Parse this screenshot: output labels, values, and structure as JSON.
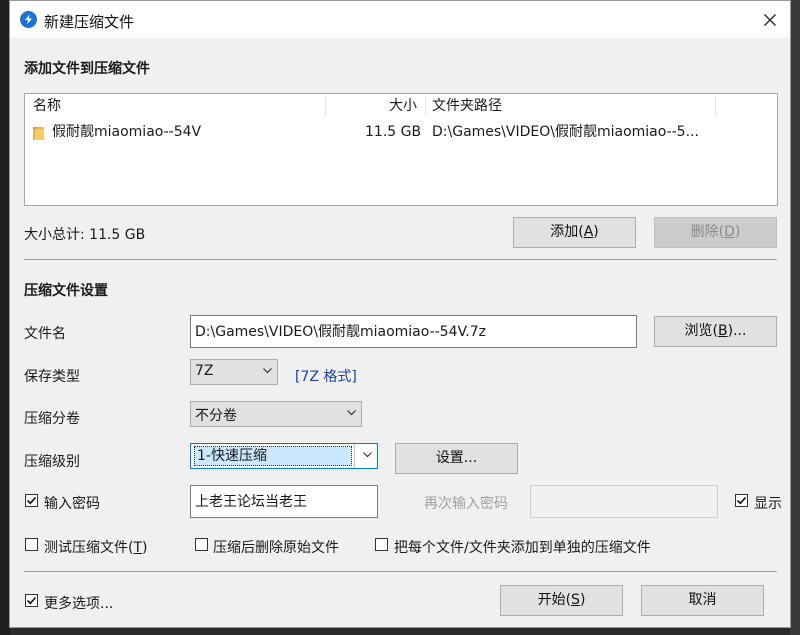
{
  "window": {
    "title": "新建压缩文件",
    "close_glyph": "close-icon"
  },
  "files": {
    "section_title": "添加文件到压缩文件",
    "columns": [
      "名称",
      "大小",
      "文件夹路径"
    ],
    "rows": [
      {
        "name": "假耐靓miaomiao--54V",
        "size": "11.5 GB",
        "path": "D:\\Games\\VIDEO\\假耐靓miaomiao--5...",
        "icon": "folder-icon"
      }
    ],
    "total_label": "大小总计: 11.5 GB",
    "add_button": {
      "text": "添加",
      "hotkey_open": "(",
      "hotkey": "A",
      "hotkey_close": ")"
    },
    "delete_button": {
      "text": "删除",
      "hotkey_open": "(",
      "hotkey": "D",
      "hotkey_close": ")"
    }
  },
  "settings": {
    "section_title": "压缩文件设置",
    "filename_label": "文件名",
    "filename_value": "D:\\Games\\VIDEO\\假耐靓miaomiao--54V.7z",
    "browse_button": {
      "text": "浏览",
      "hotkey_open": "(",
      "hotkey": "B",
      "hotkey_close": ")..."
    },
    "save_type_label": "保存类型",
    "save_type_value": "7Z",
    "format_link": "[7Z 格式]",
    "split_label": "压缩分卷",
    "split_value": "不分卷",
    "level_label": "压缩级别",
    "level_value": "1-快速压缩",
    "level_settings_button": "设置...",
    "password_label": "输入密码",
    "password_value": "上老王论坛当老王",
    "password_checked": true,
    "repeat_password_label": "再次输入密码",
    "show_label": "显示",
    "show_checked": true,
    "test_label_text": "测试压缩文件",
    "test_hotkey_open": "(",
    "test_hotkey": "T",
    "test_hotkey_close": ")",
    "test_checked": false,
    "delete_after_label": "压缩后删除原始文件",
    "delete_after_checked": false,
    "separate_label": "把每个文件/文件夹添加到单独的压缩文件",
    "separate_checked": false
  },
  "footer": {
    "more_options_label": "更多选项...",
    "more_options_checked": true,
    "start_button": {
      "text": "开始",
      "hotkey_open": "(",
      "hotkey": "S",
      "hotkey_close": ")"
    },
    "cancel_button": "取消"
  },
  "colors": {
    "accent": "#0078d7",
    "link": "#1a3fa8",
    "panel": "#f0f0f0",
    "selection": "#cce8ff"
  }
}
